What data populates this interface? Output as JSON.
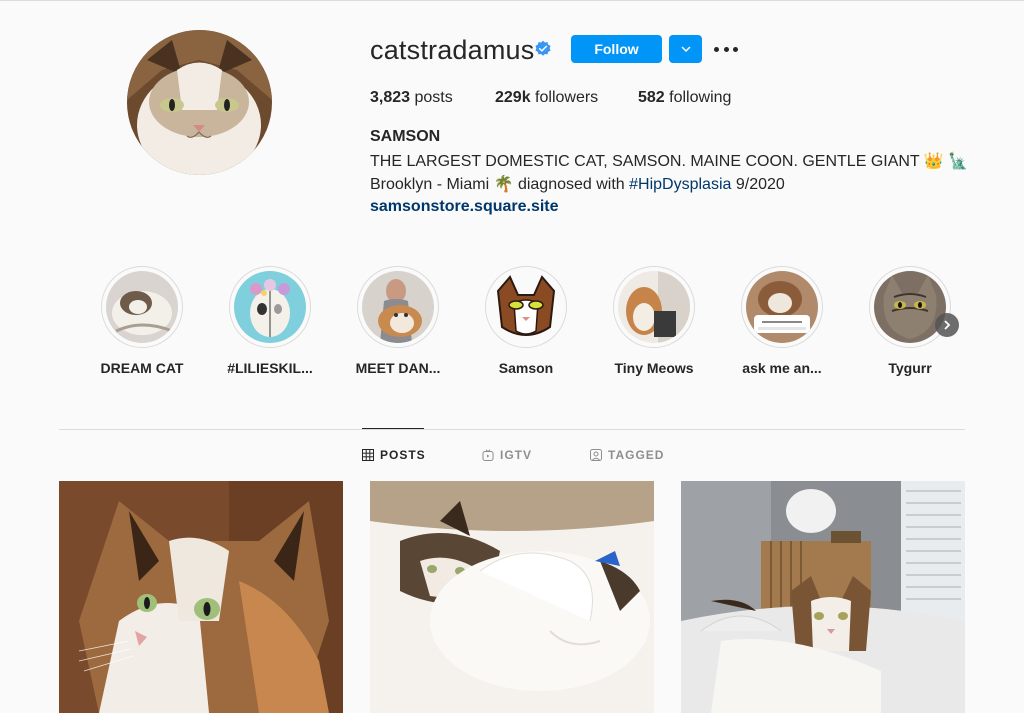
{
  "profile": {
    "username": "catstradamus",
    "verified": true,
    "follow_label": "Follow",
    "stats": {
      "posts_count": "3,823",
      "posts_label": "posts",
      "followers_count": "229k",
      "followers_label": "followers",
      "following_count": "582",
      "following_label": "following"
    },
    "bio": {
      "name": "SAMSON",
      "line1": "THE LARGEST DOMESTIC CAT, SAMSON. MAINE COON. GENTLE GIANT 👑 🗽",
      "line2_prefix": "Brooklyn - Miami 🌴 diagnosed with ",
      "line2_hashtag": "#HipDysplasia",
      "line2_suffix": " 9/2020",
      "link": "samsonstore.square.site"
    }
  },
  "highlights": [
    {
      "label": "DREAM CAT"
    },
    {
      "label": "#LILIESKIL..."
    },
    {
      "label": "MEET DAN..."
    },
    {
      "label": "Samson"
    },
    {
      "label": "Tiny Meows"
    },
    {
      "label": "ask me an..."
    },
    {
      "label": "Tygurr"
    }
  ],
  "tabs": [
    {
      "label": "POSTS",
      "icon": "grid-icon",
      "active": true
    },
    {
      "label": "IGTV",
      "icon": "igtv-icon",
      "active": false
    },
    {
      "label": "TAGGED",
      "icon": "tagged-icon",
      "active": false
    }
  ],
  "colors": {
    "accent": "#0095f6",
    "link": "#00376b",
    "text": "#262626",
    "muted": "#8e8e8e",
    "background": "#fafafa"
  }
}
